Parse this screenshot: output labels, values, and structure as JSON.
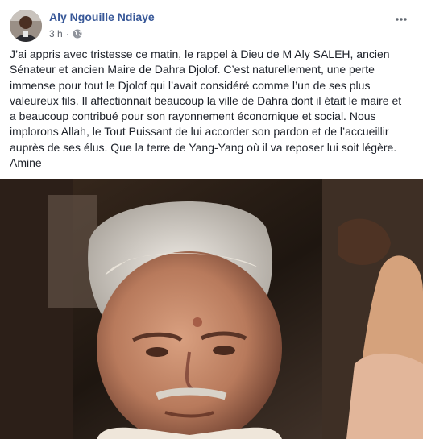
{
  "post": {
    "author": "Aly Ngouille Ndiaye",
    "time": "3 h",
    "separator": "·",
    "privacy_icon": "globe-icon",
    "more_icon": "more-options-icon",
    "text": "J’ai appris avec tristesse ce matin, le rappel à Dieu de M Aly SALEH, ancien Sénateur et ancien Maire de Dahra Djolof. C’est naturellement, une perte immense pour tout le Djolof qui l’avait considéré comme l’un de ses plus valeureux fils. Il affectionnait beaucoup la ville de Dahra dont il était le maire et a beaucoup contribué pour son rayonnement économique et social. Nous implorons Allah, le Tout Puissant de lui accorder son pardon et de l’accueillir auprès de ses élus. Que la terre de Yang-Yang où il va reposer lui soit légère. Amine"
  },
  "colors": {
    "author_link": "#385898",
    "meta_text": "#616770",
    "body_text": "#1d2129"
  }
}
